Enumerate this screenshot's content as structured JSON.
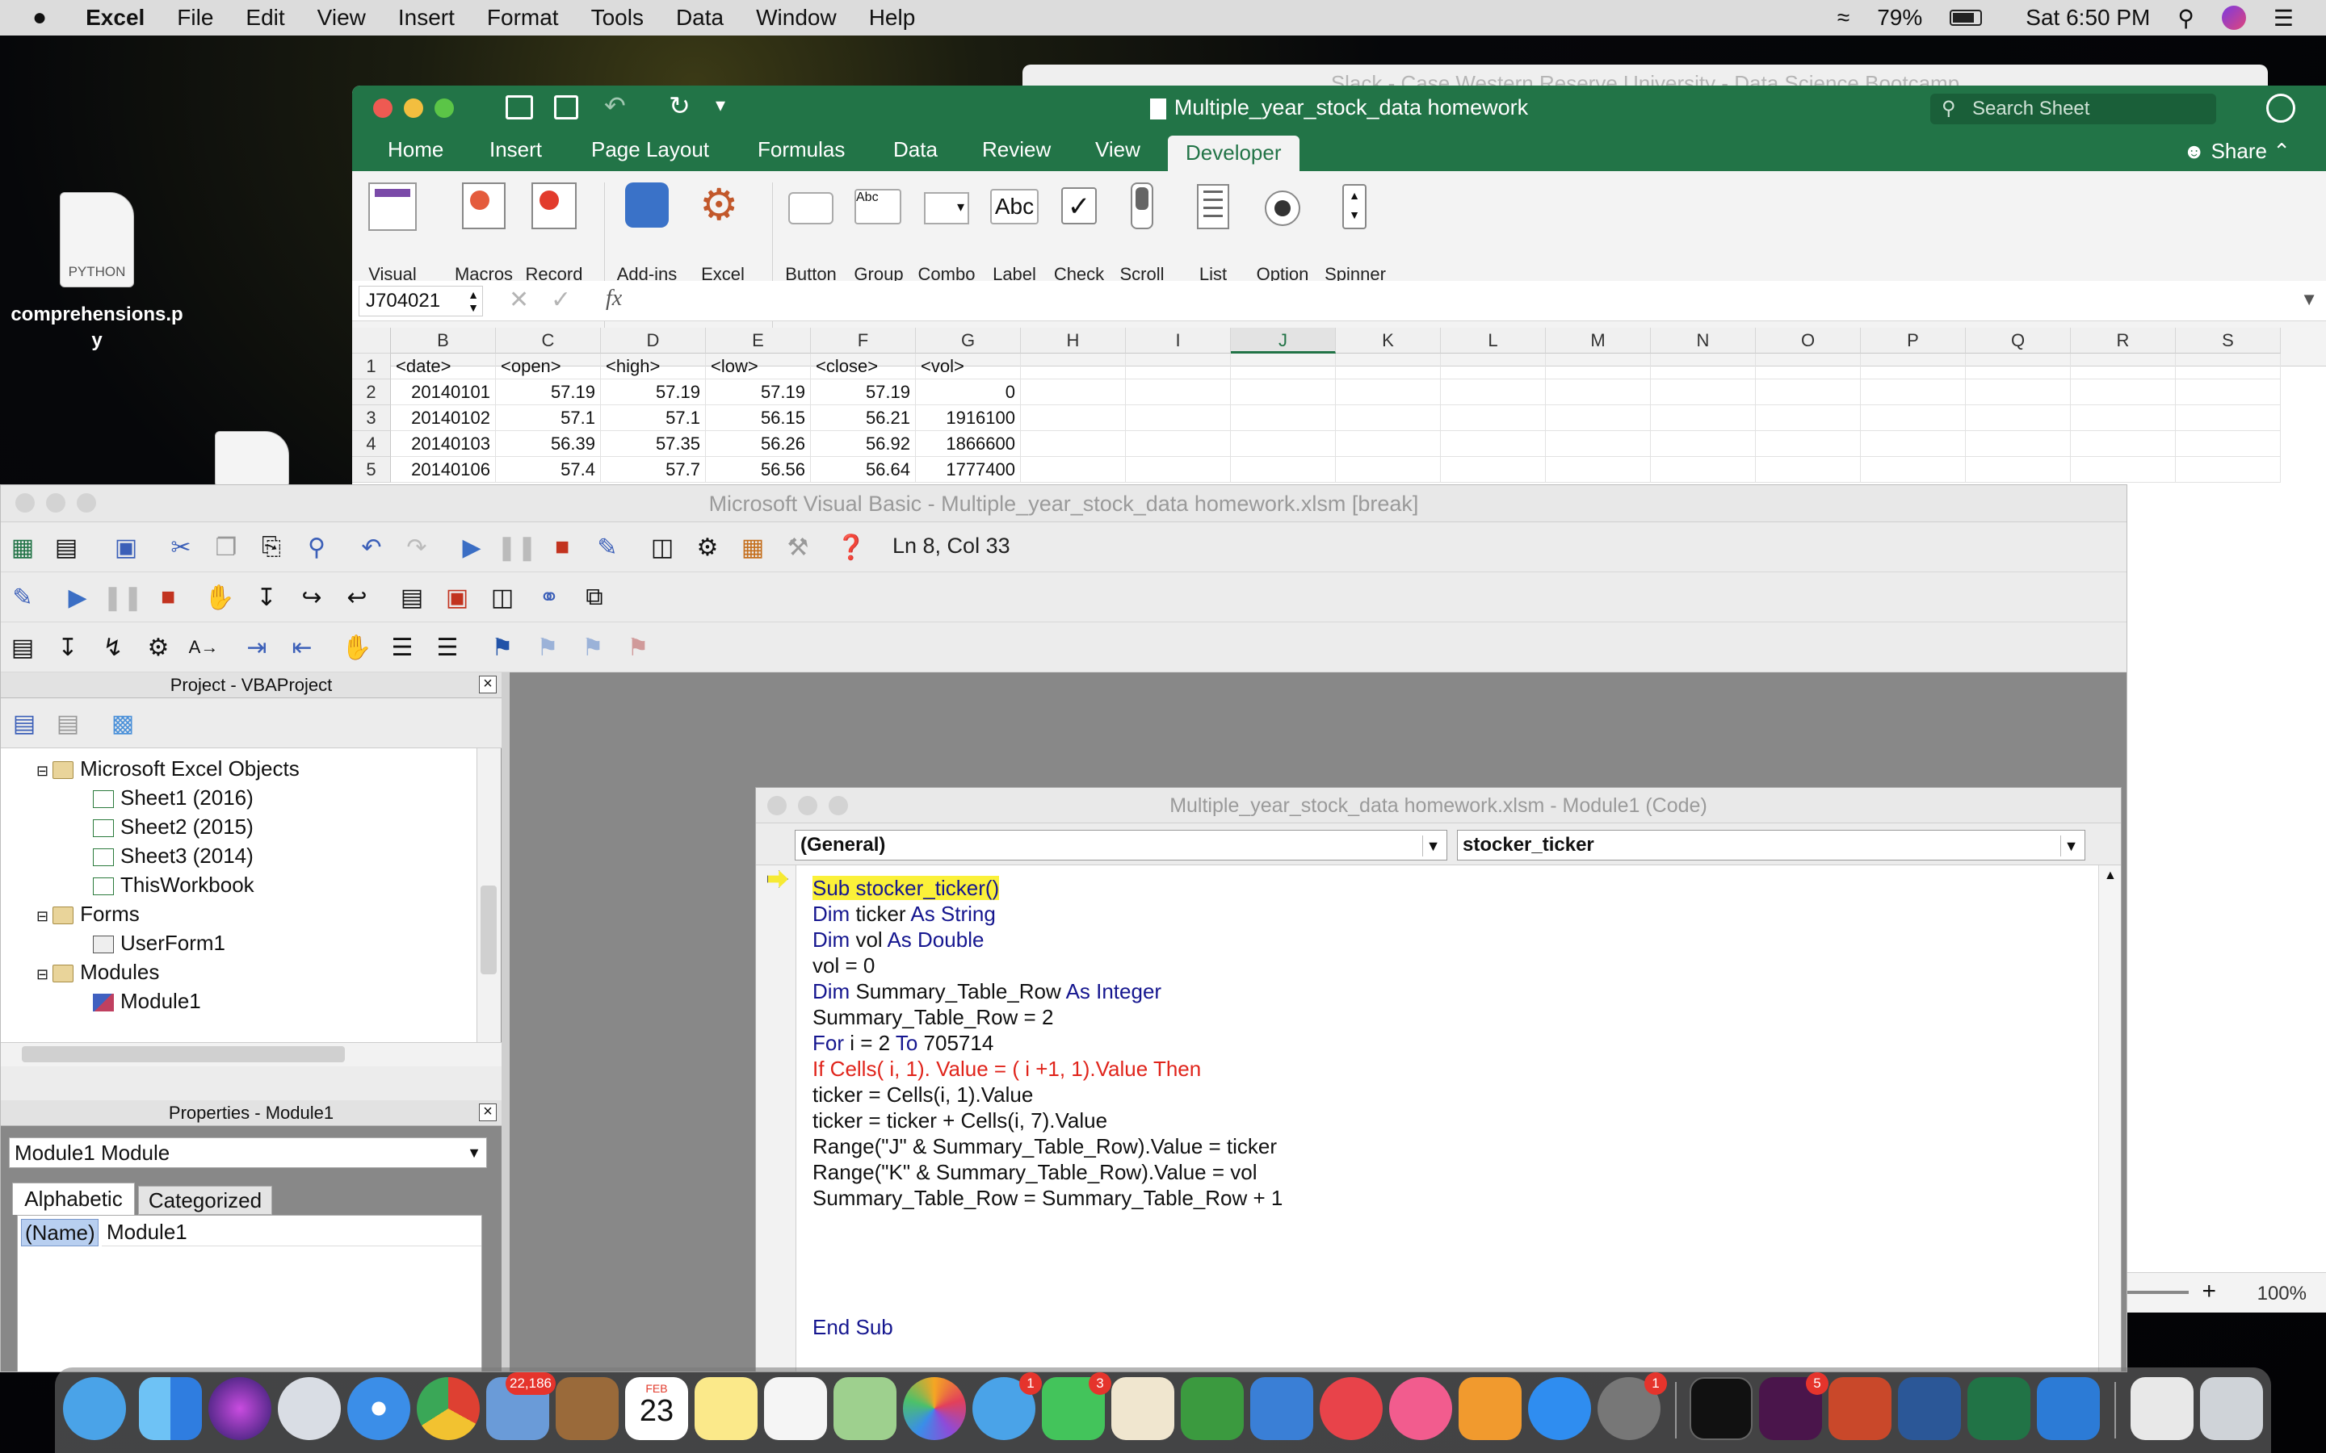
{
  "menubar": {
    "apple": "",
    "app_name": "Excel",
    "items": [
      "File",
      "Edit",
      "View",
      "Insert",
      "Format",
      "Tools",
      "Data",
      "Window",
      "Help"
    ],
    "battery": "79%",
    "clock": "Sat 6:50 PM"
  },
  "desktop": {
    "file1_tag": "PYTHON",
    "file1_name": "comprehensions.p\ny"
  },
  "slack": {
    "title": "Slack - Case Western Reserve University - Data Science Bootcamp"
  },
  "excel": {
    "doc_title": "Multiple_year_stock_data homework",
    "search_placeholder": "Search Sheet",
    "share": "Share",
    "tabs": [
      "Home",
      "Insert",
      "Page Layout",
      "Formulas",
      "Data",
      "Review",
      "View",
      "Developer"
    ],
    "active_tab": "Developer",
    "ribbon": [
      {
        "name": "visual-basic",
        "label": "Visual\nBasic"
      },
      {
        "name": "macros",
        "label": "Macros"
      },
      {
        "name": "record-macro",
        "label": "Record\nMacro"
      },
      {
        "name": "add-ins",
        "label": "Add-ins"
      },
      {
        "name": "excel-add-ins",
        "label": "Excel\nAdd-ins"
      },
      {
        "name": "button",
        "label": "Button"
      },
      {
        "name": "group-box",
        "label": "Group\nBox"
      },
      {
        "name": "combo-box",
        "label": "Combo\nBox"
      },
      {
        "name": "label",
        "label": "Label"
      },
      {
        "name": "check-box",
        "label": "Check\nBox"
      },
      {
        "name": "scroll-bar",
        "label": "Scroll\nBar"
      },
      {
        "name": "list-box",
        "label": "List\nBox"
      },
      {
        "name": "option-button",
        "label": "Option\nButton"
      },
      {
        "name": "spinner",
        "label": "Spinner"
      }
    ],
    "ribbon_glyphs": {
      "group_box": "Abc",
      "label": "Abc"
    },
    "name_box": "J704021",
    "fx": "fx",
    "columns": [
      "B",
      "C",
      "D",
      "E",
      "F",
      "G",
      "H",
      "I",
      "J",
      "K",
      "L",
      "M",
      "N",
      "O",
      "P",
      "Q",
      "R",
      "S"
    ],
    "selected_column": "J",
    "rows": [
      {
        "num": "1",
        "cells": [
          "<date>",
          "<open>",
          "<high>",
          "<low>",
          "<close>",
          "<vol>"
        ]
      },
      {
        "num": "2",
        "cells": [
          "20140101",
          "57.19",
          "57.19",
          "57.19",
          "57.19",
          "0"
        ]
      },
      {
        "num": "3",
        "cells": [
          "20140102",
          "57.1",
          "57.1",
          "56.15",
          "56.21",
          "1916100"
        ]
      },
      {
        "num": "4",
        "cells": [
          "20140103",
          "56.39",
          "57.35",
          "56.26",
          "56.92",
          "1866600"
        ]
      },
      {
        "num": "5",
        "cells": [
          "20140106",
          "57.4",
          "57.7",
          "56.56",
          "56.64",
          "1777400"
        ]
      }
    ],
    "zoom": "100%"
  },
  "vba": {
    "title": "Microsoft Visual Basic - Multiple_year_stock_data homework.xlsm [break]",
    "cursor_pos": "Ln 8, Col 33",
    "project_title": "Project - VBAProject",
    "tree": {
      "excel_objects": "Microsoft Excel Objects",
      "sheet1": "Sheet1 (2016)",
      "sheet2": "Sheet2 (2015)",
      "sheet3": "Sheet3 (2014)",
      "workbook": "ThisWorkbook",
      "forms": "Forms",
      "userform": "UserForm1",
      "modules": "Modules",
      "module1": "Module1"
    },
    "properties_title": "Properties - Module1",
    "properties_object": "Module1 Module",
    "prop_tab_alpha": "Alphabetic",
    "prop_tab_cat": "Categorized",
    "prop_name_key": "(Name)",
    "prop_name_value": "Module1",
    "code_window_title": "Multiple_year_stock_data homework.xlsm - Module1 (Code)",
    "object_combo": "(General)",
    "proc_combo": "stocker_ticker",
    "code": {
      "l1": "Sub stocker_ticker()",
      "l2_kw": "Dim",
      "l2_rest": " ticker ",
      "l2_kw2": "As String",
      "l3_kw": "Dim",
      "l3_rest": " vol ",
      "l3_kw2": "As Double",
      "l4": "vol = 0",
      "l5_kw": "Dim",
      "l5_rest": " Summary_Table_Row ",
      "l5_kw2": "As Integer",
      "l6": "Summary_Table_Row = 2",
      "l7_kw": "For",
      "l7_rest": " i = 2 ",
      "l7_kw2": "To",
      "l7_rest2": " 705714",
      "l8": "If Cells( i, 1). Value = ( i +1, 1).Value Then",
      "l9": "ticker = Cells(i, 1).Value",
      "l10": "ticker = ticker + Cells(i, 7).Value",
      "l11": "Range(\"J\" & Summary_Table_Row).Value = ticker",
      "l12": "Range(\"K\" & Summary_Table_Row).Value = vol",
      "l13": "Summary_Table_Row = Summary_Table_Row + 1",
      "end": "End Sub"
    }
  },
  "dock": {
    "mail_badge": "22,186",
    "cal_month": "FEB",
    "cal_day": "23",
    "messages_badge": "1",
    "facetime_badge": "3",
    "prefs_badge": "1",
    "slack_badge": "5"
  }
}
